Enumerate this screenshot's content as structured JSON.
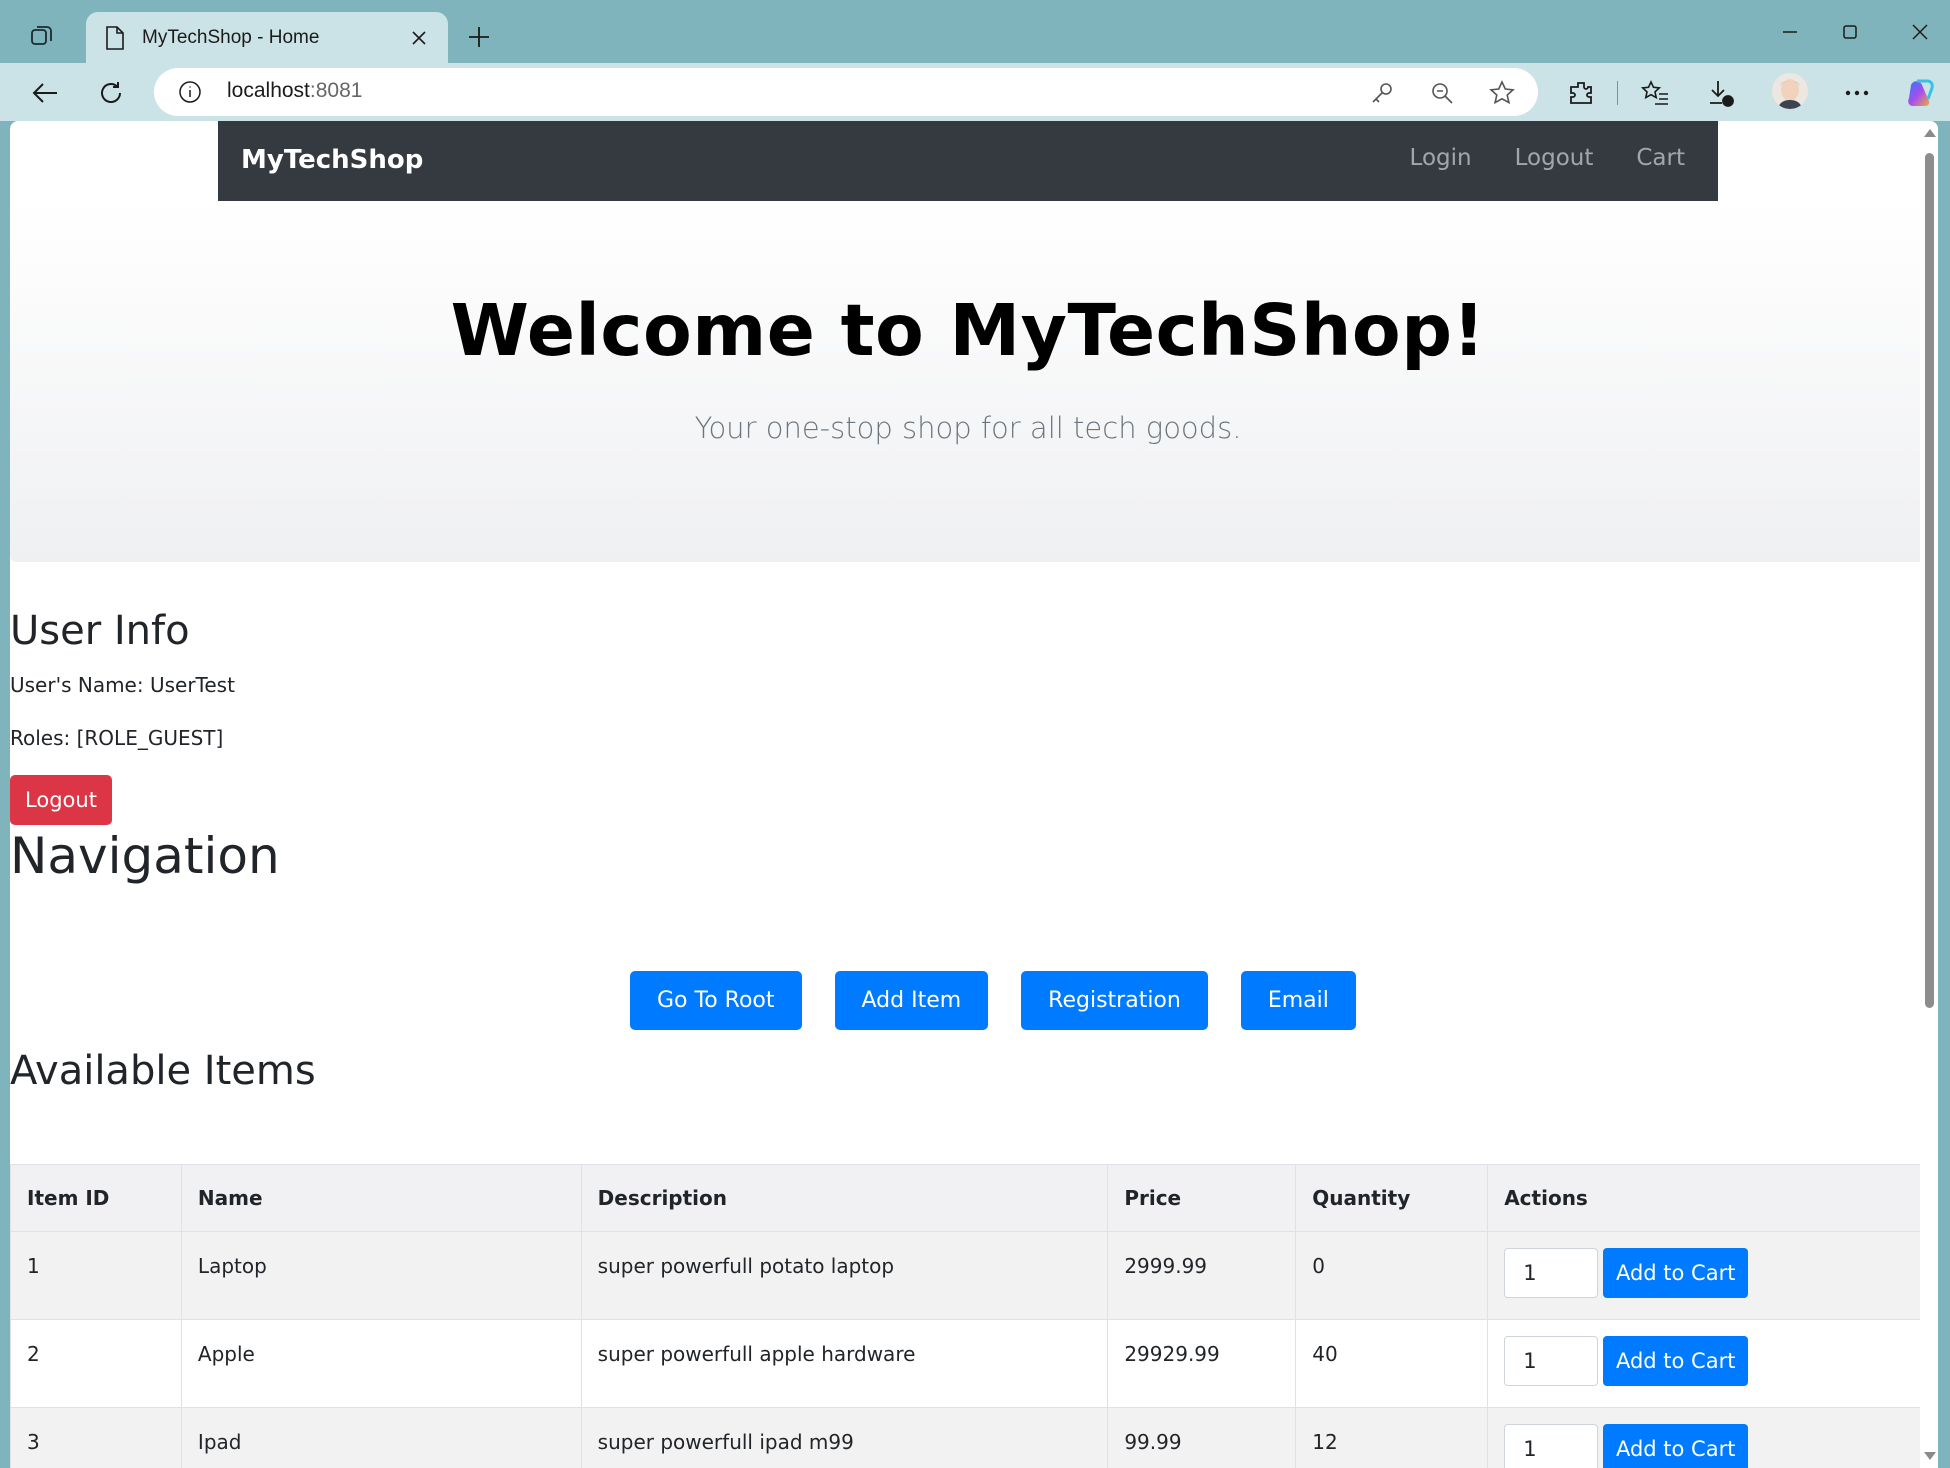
{
  "browser": {
    "tab_title": "MyTechShop - Home",
    "url_host": "localhost",
    "url_port": ":8081"
  },
  "site": {
    "brand": "MyTechShop",
    "nav_links": [
      "Login",
      "Logout",
      "Cart"
    ],
    "hero": {
      "title": "Welcome to MyTechShop!",
      "subtitle": "Your one-stop shop for all tech goods."
    },
    "user_info": {
      "heading": "User Info",
      "name_line": "User's Name: UserTest",
      "roles_line": "Roles: [ROLE_GUEST]",
      "logout_button": "Logout"
    },
    "navigation": {
      "heading": "Navigation",
      "buttons": [
        "Go To Root",
        "Add Item",
        "Registration",
        "Email"
      ]
    },
    "items": {
      "heading": "Available Items",
      "columns": [
        "Item ID",
        "Name",
        "Description",
        "Price",
        "Quantity",
        "Actions"
      ],
      "rows": [
        {
          "id": "1",
          "name": "Laptop",
          "description": "super powerfull potato laptop",
          "price": "2999.99",
          "quantity": "0",
          "qty_value": "1",
          "action": "Add to Cart"
        },
        {
          "id": "2",
          "name": "Apple",
          "description": "super powerfull apple hardware",
          "price": "29929.99",
          "quantity": "40",
          "qty_value": "1",
          "action": "Add to Cart"
        },
        {
          "id": "3",
          "name": "Ipad",
          "description": "super powerfull ipad m99",
          "price": "99.99",
          "quantity": "12",
          "qty_value": "1",
          "action": "Add to Cart"
        }
      ]
    }
  },
  "colors": {
    "navbar": "#343a40",
    "primary": "#007bff",
    "danger": "#dc3545",
    "browser_frame": "#7fb4bd",
    "browser_toolbar": "#cbe3e6"
  }
}
